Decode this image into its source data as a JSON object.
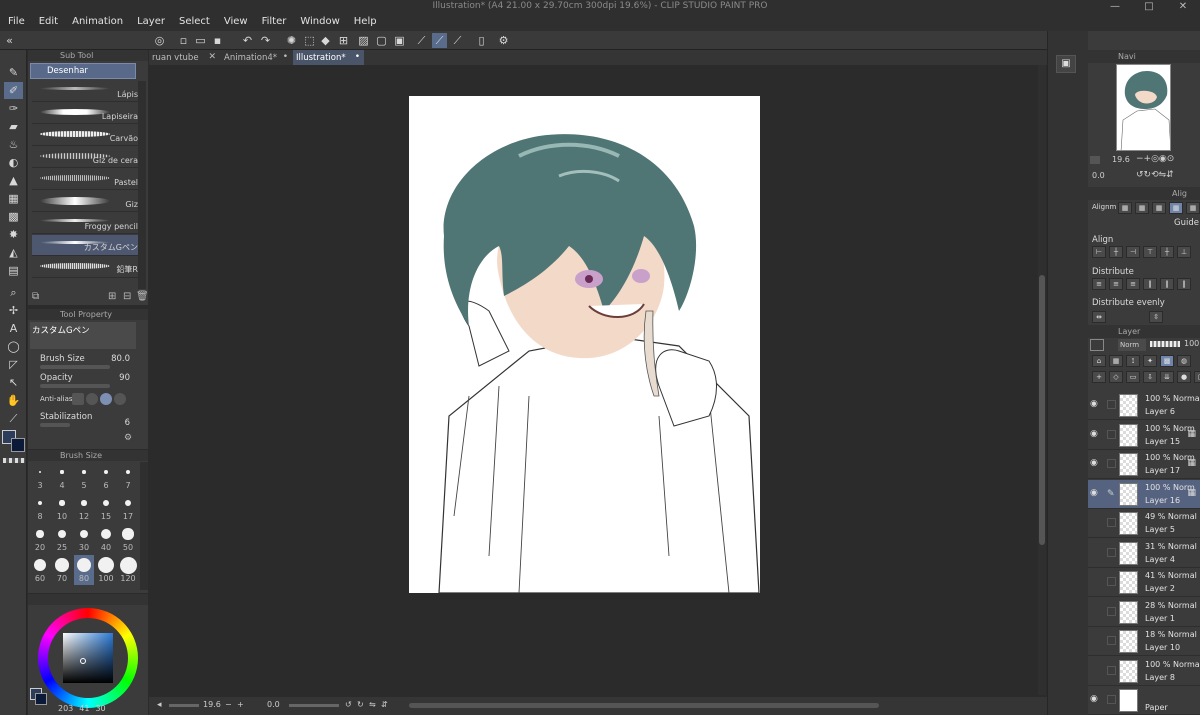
{
  "window": {
    "title": "Illustration* (A4 21.00 x 29.70cm 300dpi 19.6%) - CLIP STUDIO PAINT PRO",
    "controls": [
      "—",
      "□",
      "✕"
    ]
  },
  "menu": [
    "File",
    "Edit",
    "Animation",
    "Layer",
    "Select",
    "View",
    "Filter",
    "Window",
    "Help"
  ],
  "subtool": {
    "title": "Sub Tool",
    "group": "Desenhar",
    "brushes": [
      {
        "label": "Lápis"
      },
      {
        "label": "Lapiseira"
      },
      {
        "label": "Carvão"
      },
      {
        "label": "Giz de cera"
      },
      {
        "label": "Pastel"
      },
      {
        "label": "Giz"
      },
      {
        "label": "Froggy pencil"
      },
      {
        "label": "カスタムGペン"
      },
      {
        "label": "鉛筆R"
      }
    ]
  },
  "tool_property": {
    "title": "Tool Property",
    "preset": "カスタムGペン",
    "brush_size_label": "Brush Size",
    "brush_size_value": "80.0",
    "opacity_label": "Opacity",
    "opacity_value": "90",
    "antialias_label": "Anti-aliasing",
    "stabilization_label": "Stabilization",
    "stabilization_value": "6"
  },
  "brush_size": {
    "title": "Brush Size",
    "sizes": [
      "3",
      "4",
      "5",
      "6",
      "7",
      "8",
      "10",
      "12",
      "15",
      "17",
      "20",
      "25",
      "30",
      "40",
      "50",
      "60",
      "70",
      "80",
      "100",
      "120"
    ]
  },
  "color": {
    "main": "#2b3d5a",
    "sub": "#0c1a3a",
    "footer_values": [
      "203",
      "41",
      "30"
    ]
  },
  "tabs": [
    {
      "label": "ruan vtube"
    },
    {
      "label": "Animation4*"
    },
    {
      "label": "Illustration*"
    }
  ],
  "status": {
    "zoom": "19.6",
    "angle": "0.0"
  },
  "navigator": {
    "title": "Navi",
    "zoom": "19.6",
    "angle": "0.0"
  },
  "align": {
    "title": "Alig",
    "alignment_label": "Alignm",
    "guide": "Guide",
    "align": "Align",
    "distribute": "Distribute",
    "distribute_evenly": "Distribute evenly"
  },
  "layers": {
    "title": "Layer",
    "blend": "Norm",
    "opacity": "100",
    "items": [
      {
        "mode": "100 % Normal",
        "name": "Layer 6"
      },
      {
        "mode": "100 % Norm",
        "name": "Layer 15"
      },
      {
        "mode": "100 % Norm",
        "name": "Layer 17"
      },
      {
        "mode": "100 % Norm",
        "name": "Layer 16"
      },
      {
        "mode": "49 % Normal",
        "name": "Layer 5"
      },
      {
        "mode": "31 % Normal",
        "name": "Layer 4"
      },
      {
        "mode": "41 % Normal",
        "name": "Layer 2"
      },
      {
        "mode": "28 % Normal",
        "name": "Layer 1"
      },
      {
        "mode": "18 % Normal",
        "name": "Layer 10"
      },
      {
        "mode": "100 % Normal",
        "name": "Layer 8"
      },
      {
        "mode": "",
        "name": "Paper"
      }
    ]
  }
}
